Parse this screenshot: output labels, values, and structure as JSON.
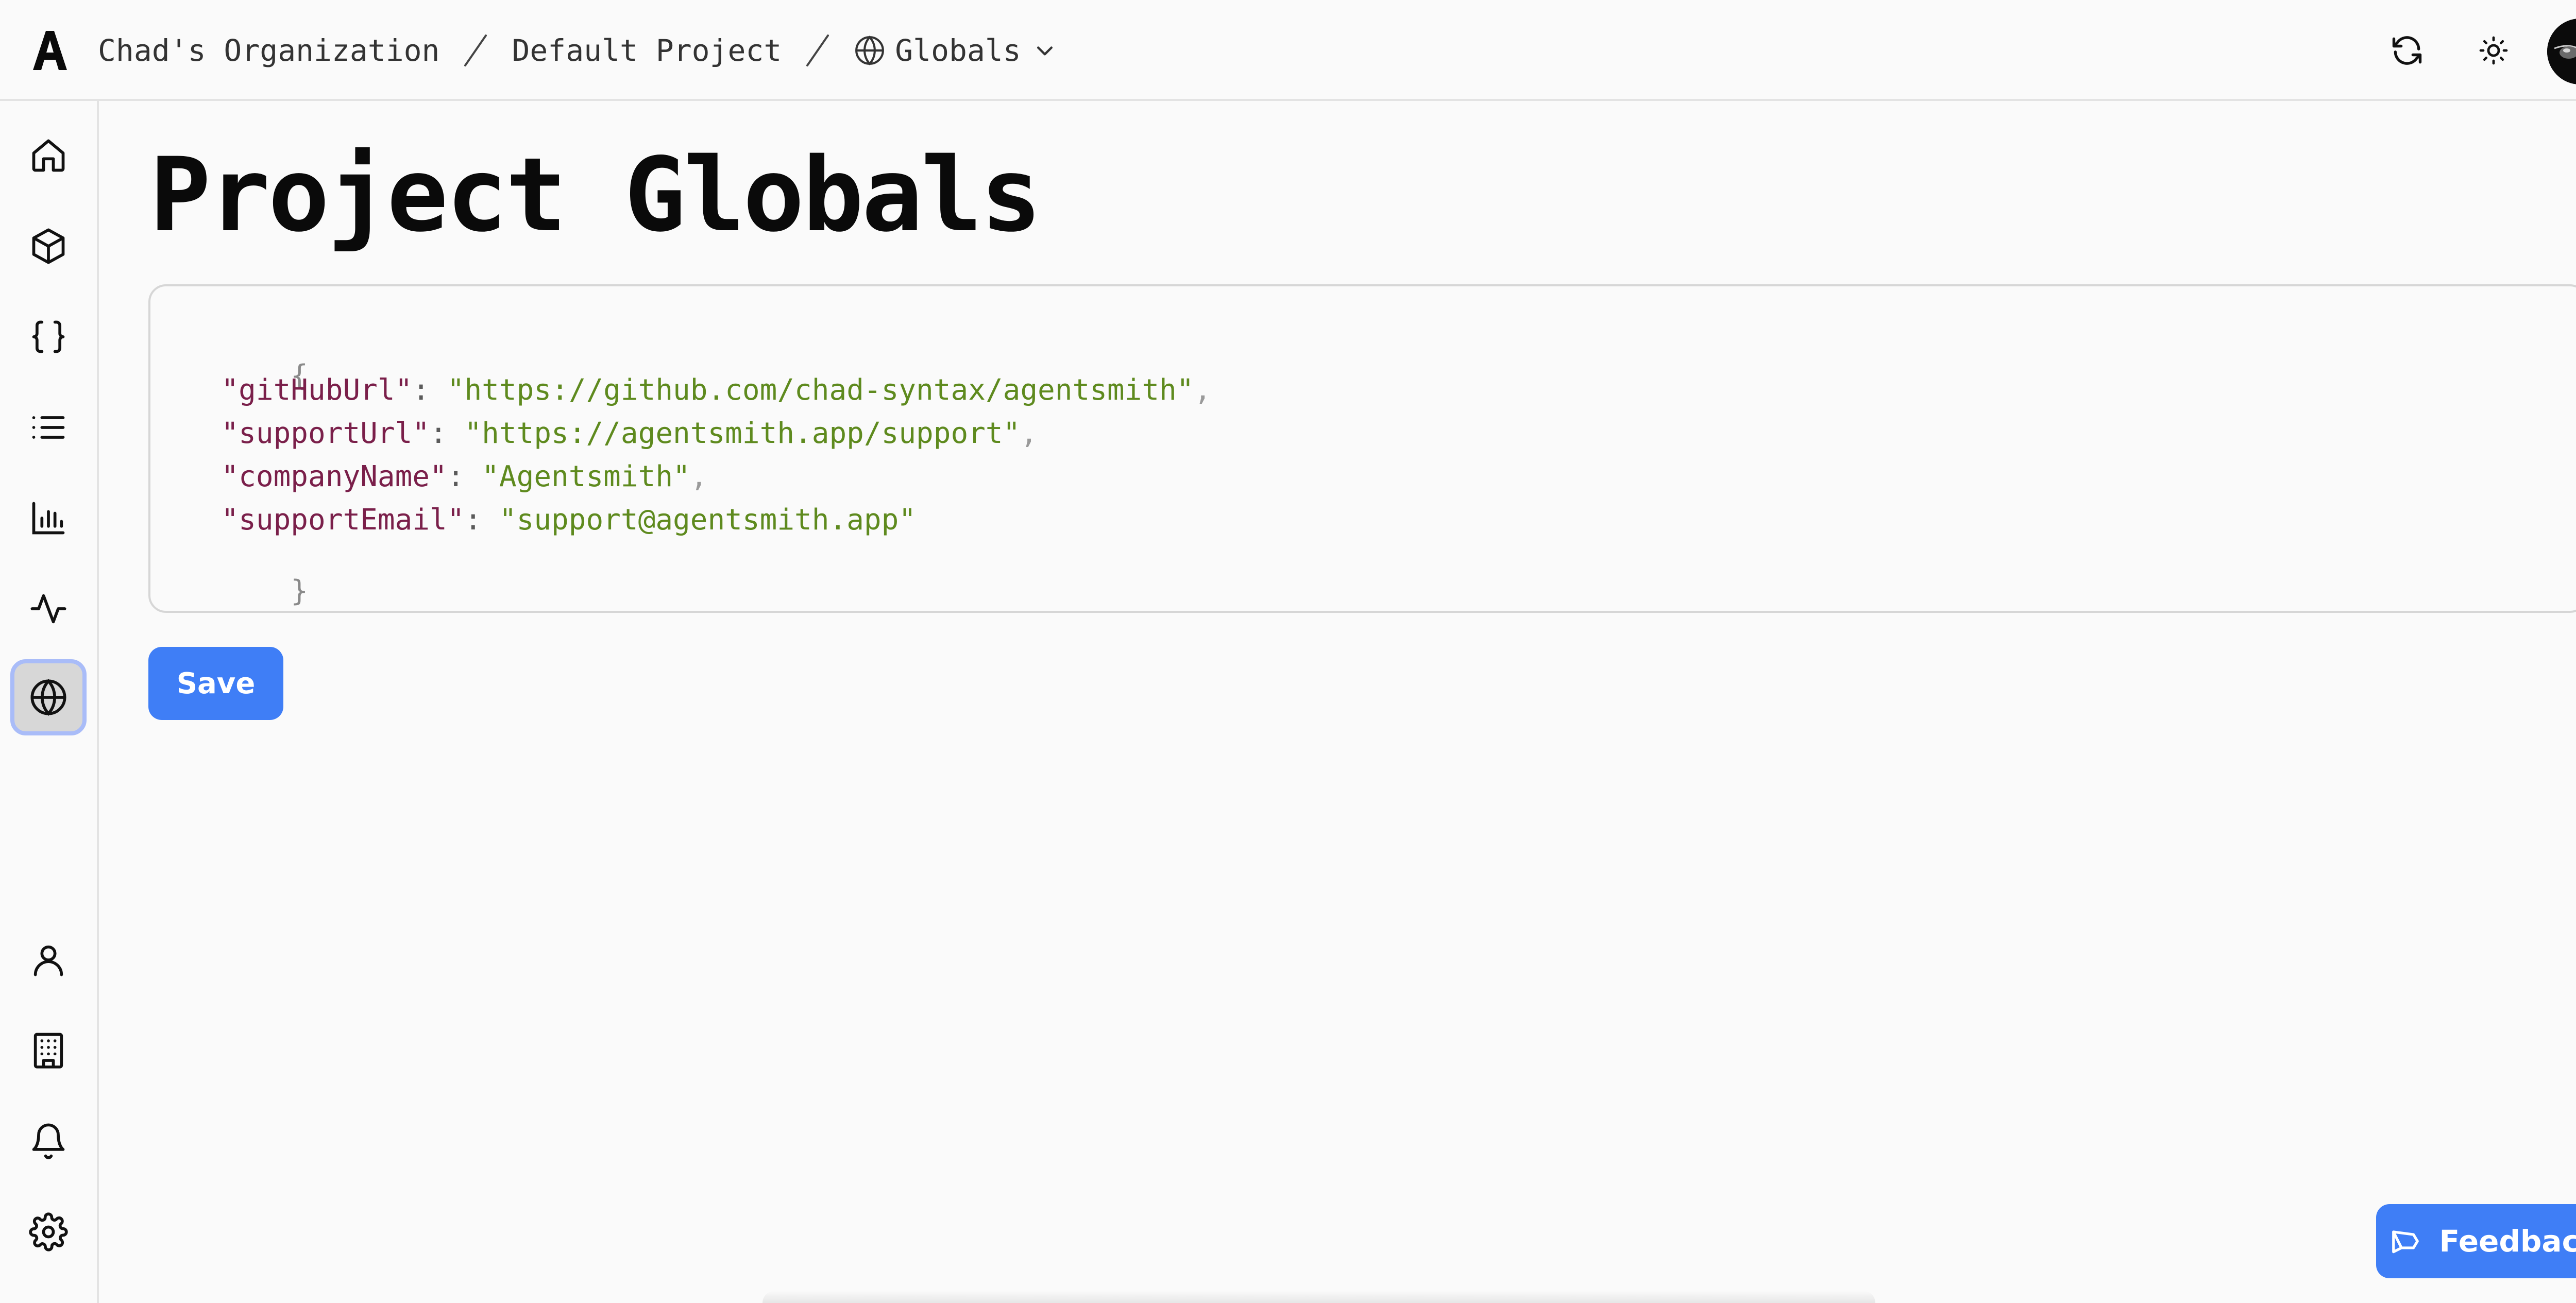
{
  "header": {
    "logo": "A",
    "breadcrumbs": [
      "Chad's Organization",
      "Default Project"
    ],
    "current": "Globals",
    "icons": [
      "refresh-icon",
      "sun-icon"
    ],
    "avatar": "user-avatar"
  },
  "sidebar": {
    "top_items": [
      {
        "name": "home",
        "icon": "home-icon"
      },
      {
        "name": "prompts",
        "icon": "cube-icon"
      },
      {
        "name": "variables",
        "icon": "braces-icon"
      },
      {
        "name": "logs",
        "icon": "list-icon"
      },
      {
        "name": "metrics",
        "icon": "bar-chart-icon"
      },
      {
        "name": "activity",
        "icon": "pulse-icon"
      },
      {
        "name": "globals",
        "icon": "globe-icon",
        "active": true
      }
    ],
    "bottom_items": [
      {
        "name": "account",
        "icon": "user-icon"
      },
      {
        "name": "organization",
        "icon": "building-icon"
      },
      {
        "name": "notifications",
        "icon": "bell-icon"
      },
      {
        "name": "settings",
        "icon": "gear-icon"
      }
    ]
  },
  "main": {
    "title": "Project Globals",
    "editor": {
      "open_brace": "{",
      "close_brace": "}",
      "entries": [
        {
          "key": "\"gitHubUrl\"",
          "value": "\"https://github.com/chad-syntax/agentsmith\""
        },
        {
          "key": "\"supportUrl\"",
          "value": "\"https://agentsmith.app/support\""
        },
        {
          "key": "\"companyName\"",
          "value": "\"Agentsmith\""
        },
        {
          "key": "\"supportEmail\"",
          "value": "\"support@agentsmith.app\""
        }
      ]
    },
    "save_label": "Save"
  },
  "feedback_label": "Feedback",
  "colors": {
    "accent": "#3f7ef6",
    "json_key": "#7a1f4a",
    "json_string": "#5e8a1e",
    "active_ring": "#a9bcf8"
  }
}
